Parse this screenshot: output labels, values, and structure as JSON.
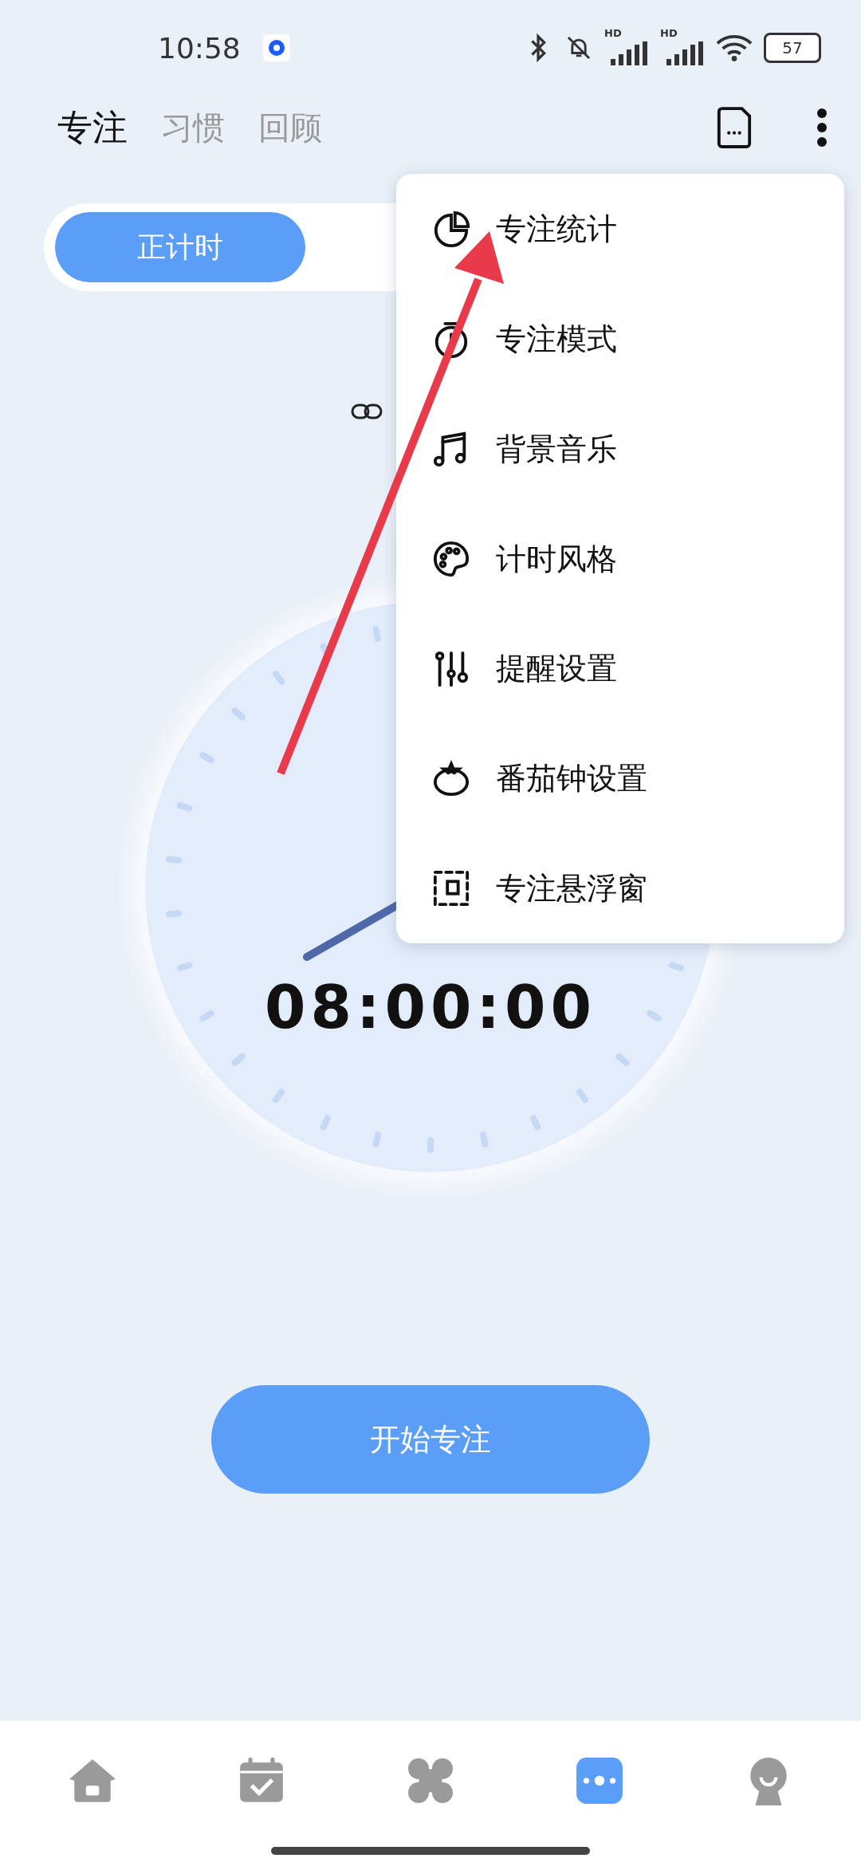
{
  "status_bar": {
    "time": "10:58",
    "signals": [
      {
        "label": "HD"
      },
      {
        "label": "HD"
      }
    ],
    "battery": "57"
  },
  "header_tabs": [
    {
      "label": "专注",
      "selected": true
    },
    {
      "label": "习惯",
      "selected": false
    },
    {
      "label": "回顾",
      "selected": false
    }
  ],
  "mode_tabs": [
    {
      "label": "正计时",
      "selected": true
    }
  ],
  "timer": {
    "display": "08:00:00"
  },
  "start_button": "开始专注",
  "menu": {
    "items": [
      {
        "label": "专注统计",
        "kind": "pie"
      },
      {
        "label": "专注模式",
        "kind": "timer"
      },
      {
        "label": "背景音乐",
        "kind": "music"
      },
      {
        "label": "计时风格",
        "kind": "palette"
      },
      {
        "label": "提醒设置",
        "kind": "sliders"
      },
      {
        "label": "番茄钟设置",
        "kind": "tomato"
      },
      {
        "label": "专注悬浮窗",
        "kind": "float"
      }
    ]
  },
  "bottom_nav": [
    {
      "kind": "home",
      "selected": false
    },
    {
      "kind": "calendar",
      "selected": false
    },
    {
      "kind": "grid",
      "selected": false
    },
    {
      "kind": "focus",
      "selected": true
    },
    {
      "kind": "profile",
      "selected": false
    }
  ]
}
